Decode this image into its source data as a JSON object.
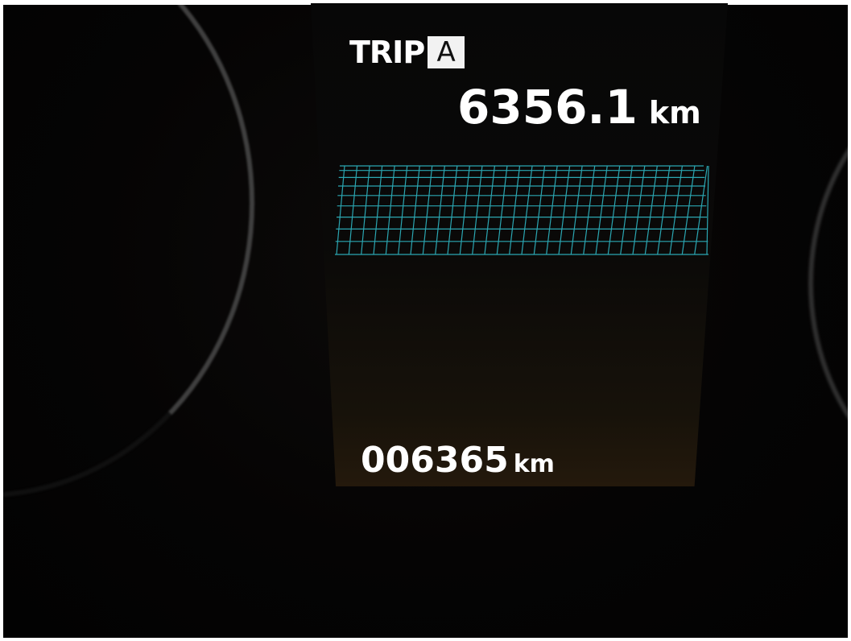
{
  "trip": {
    "label": "TRIP",
    "meter": "A",
    "distance": "6356.1",
    "unit": "km"
  },
  "odometer": {
    "value": "006365",
    "unit": "km"
  },
  "colors": {
    "text": "#ffffff",
    "grid": "#2fb7c4",
    "background": "#000000"
  }
}
